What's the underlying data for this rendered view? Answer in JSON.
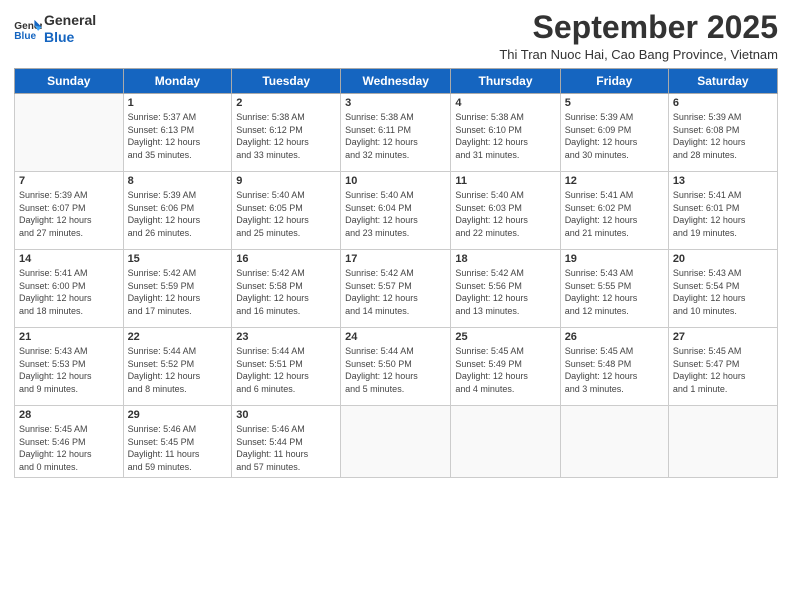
{
  "logo": {
    "line1": "General",
    "line2": "Blue"
  },
  "title": "September 2025",
  "subtitle": "Thi Tran Nuoc Hai, Cao Bang Province, Vietnam",
  "days": [
    "Sunday",
    "Monday",
    "Tuesday",
    "Wednesday",
    "Thursday",
    "Friday",
    "Saturday"
  ],
  "weeks": [
    [
      {
        "day": "",
        "text": ""
      },
      {
        "day": "1",
        "text": "Sunrise: 5:37 AM\nSunset: 6:13 PM\nDaylight: 12 hours\nand 35 minutes."
      },
      {
        "day": "2",
        "text": "Sunrise: 5:38 AM\nSunset: 6:12 PM\nDaylight: 12 hours\nand 33 minutes."
      },
      {
        "day": "3",
        "text": "Sunrise: 5:38 AM\nSunset: 6:11 PM\nDaylight: 12 hours\nand 32 minutes."
      },
      {
        "day": "4",
        "text": "Sunrise: 5:38 AM\nSunset: 6:10 PM\nDaylight: 12 hours\nand 31 minutes."
      },
      {
        "day": "5",
        "text": "Sunrise: 5:39 AM\nSunset: 6:09 PM\nDaylight: 12 hours\nand 30 minutes."
      },
      {
        "day": "6",
        "text": "Sunrise: 5:39 AM\nSunset: 6:08 PM\nDaylight: 12 hours\nand 28 minutes."
      }
    ],
    [
      {
        "day": "7",
        "text": "Sunrise: 5:39 AM\nSunset: 6:07 PM\nDaylight: 12 hours\nand 27 minutes."
      },
      {
        "day": "8",
        "text": "Sunrise: 5:39 AM\nSunset: 6:06 PM\nDaylight: 12 hours\nand 26 minutes."
      },
      {
        "day": "9",
        "text": "Sunrise: 5:40 AM\nSunset: 6:05 PM\nDaylight: 12 hours\nand 25 minutes."
      },
      {
        "day": "10",
        "text": "Sunrise: 5:40 AM\nSunset: 6:04 PM\nDaylight: 12 hours\nand 23 minutes."
      },
      {
        "day": "11",
        "text": "Sunrise: 5:40 AM\nSunset: 6:03 PM\nDaylight: 12 hours\nand 22 minutes."
      },
      {
        "day": "12",
        "text": "Sunrise: 5:41 AM\nSunset: 6:02 PM\nDaylight: 12 hours\nand 21 minutes."
      },
      {
        "day": "13",
        "text": "Sunrise: 5:41 AM\nSunset: 6:01 PM\nDaylight: 12 hours\nand 19 minutes."
      }
    ],
    [
      {
        "day": "14",
        "text": "Sunrise: 5:41 AM\nSunset: 6:00 PM\nDaylight: 12 hours\nand 18 minutes."
      },
      {
        "day": "15",
        "text": "Sunrise: 5:42 AM\nSunset: 5:59 PM\nDaylight: 12 hours\nand 17 minutes."
      },
      {
        "day": "16",
        "text": "Sunrise: 5:42 AM\nSunset: 5:58 PM\nDaylight: 12 hours\nand 16 minutes."
      },
      {
        "day": "17",
        "text": "Sunrise: 5:42 AM\nSunset: 5:57 PM\nDaylight: 12 hours\nand 14 minutes."
      },
      {
        "day": "18",
        "text": "Sunrise: 5:42 AM\nSunset: 5:56 PM\nDaylight: 12 hours\nand 13 minutes."
      },
      {
        "day": "19",
        "text": "Sunrise: 5:43 AM\nSunset: 5:55 PM\nDaylight: 12 hours\nand 12 minutes."
      },
      {
        "day": "20",
        "text": "Sunrise: 5:43 AM\nSunset: 5:54 PM\nDaylight: 12 hours\nand 10 minutes."
      }
    ],
    [
      {
        "day": "21",
        "text": "Sunrise: 5:43 AM\nSunset: 5:53 PM\nDaylight: 12 hours\nand 9 minutes."
      },
      {
        "day": "22",
        "text": "Sunrise: 5:44 AM\nSunset: 5:52 PM\nDaylight: 12 hours\nand 8 minutes."
      },
      {
        "day": "23",
        "text": "Sunrise: 5:44 AM\nSunset: 5:51 PM\nDaylight: 12 hours\nand 6 minutes."
      },
      {
        "day": "24",
        "text": "Sunrise: 5:44 AM\nSunset: 5:50 PM\nDaylight: 12 hours\nand 5 minutes."
      },
      {
        "day": "25",
        "text": "Sunrise: 5:45 AM\nSunset: 5:49 PM\nDaylight: 12 hours\nand 4 minutes."
      },
      {
        "day": "26",
        "text": "Sunrise: 5:45 AM\nSunset: 5:48 PM\nDaylight: 12 hours\nand 3 minutes."
      },
      {
        "day": "27",
        "text": "Sunrise: 5:45 AM\nSunset: 5:47 PM\nDaylight: 12 hours\nand 1 minute."
      }
    ],
    [
      {
        "day": "28",
        "text": "Sunrise: 5:45 AM\nSunset: 5:46 PM\nDaylight: 12 hours\nand 0 minutes."
      },
      {
        "day": "29",
        "text": "Sunrise: 5:46 AM\nSunset: 5:45 PM\nDaylight: 11 hours\nand 59 minutes."
      },
      {
        "day": "30",
        "text": "Sunrise: 5:46 AM\nSunset: 5:44 PM\nDaylight: 11 hours\nand 57 minutes."
      },
      {
        "day": "",
        "text": ""
      },
      {
        "day": "",
        "text": ""
      },
      {
        "day": "",
        "text": ""
      },
      {
        "day": "",
        "text": ""
      }
    ]
  ]
}
